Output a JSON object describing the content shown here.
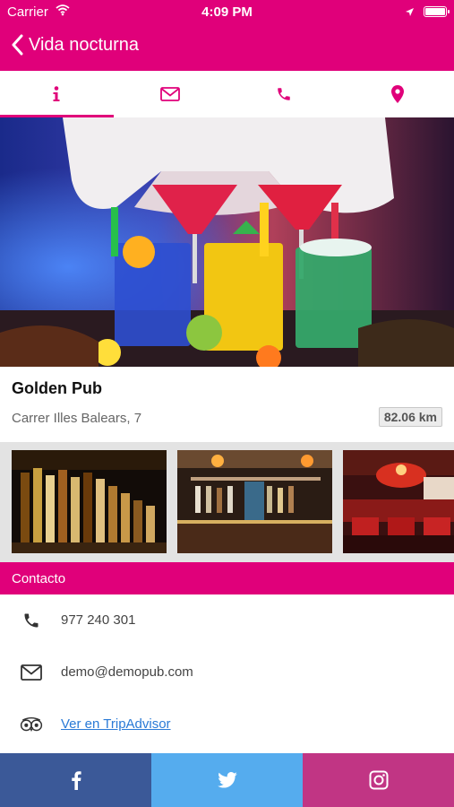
{
  "status_bar": {
    "carrier": "Carrier",
    "time": "4:09 PM"
  },
  "nav": {
    "back_title": "Vida nocturna"
  },
  "tabs": [
    {
      "icon": "info-icon",
      "active": true
    },
    {
      "icon": "envelope-icon",
      "active": false
    },
    {
      "icon": "phone-icon",
      "active": false
    },
    {
      "icon": "location-pin-icon",
      "active": false
    }
  ],
  "venue": {
    "name": "Golden Pub",
    "address": "Carrer Illes Balears, 7",
    "distance": "82.06 km"
  },
  "contact": {
    "header": "Contacto",
    "phone": "977 240 301",
    "email": "demo@demopub.com",
    "tripadvisor_link": "Ver en TripAdvisor"
  },
  "social": [
    {
      "name": "facebook",
      "color": "#3b5998"
    },
    {
      "name": "twitter",
      "color": "#55acee"
    },
    {
      "name": "instagram",
      "color": "#c13584"
    }
  ],
  "colors": {
    "accent": "#e0007a",
    "link": "#2a7ad6"
  }
}
